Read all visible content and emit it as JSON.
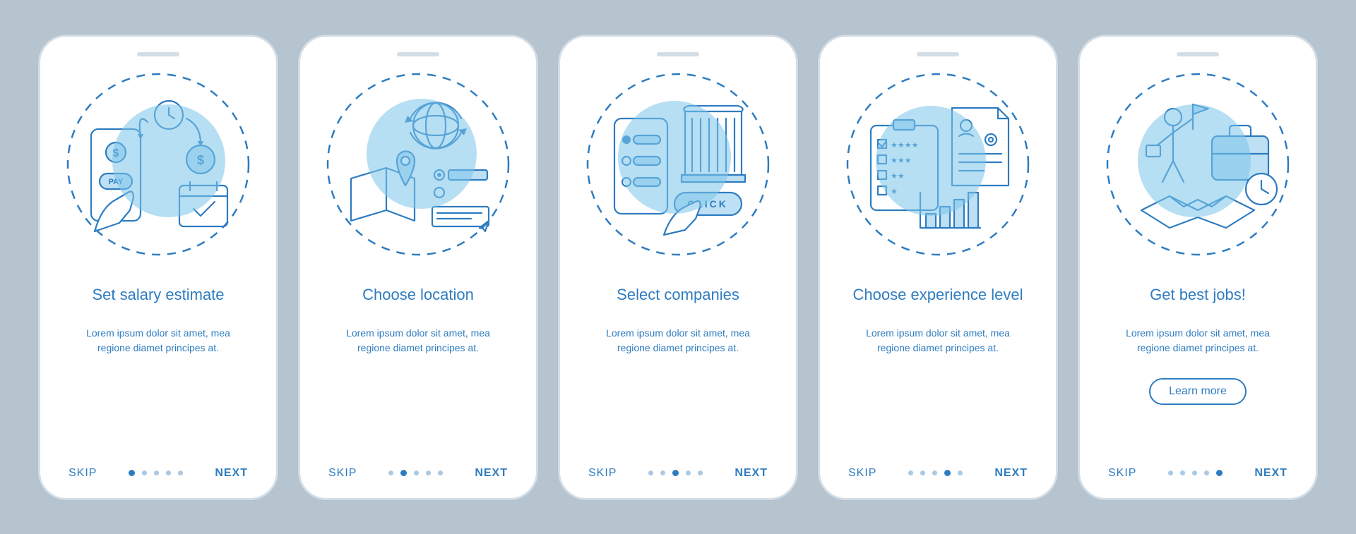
{
  "common": {
    "skip": "SKIP",
    "next": "NEXT",
    "learn_more": "Learn more",
    "lorem": "Lorem ipsum dolor sit amet, mea regione diamet principes at."
  },
  "screens": [
    {
      "title": "Set salary estimate",
      "active_dot": 0,
      "has_cta": false
    },
    {
      "title": "Choose location",
      "active_dot": 1,
      "has_cta": false
    },
    {
      "title": "Select companies",
      "active_dot": 2,
      "has_cta": false
    },
    {
      "title": "Choose experience level",
      "active_dot": 3,
      "has_cta": false
    },
    {
      "title": "Get best jobs!",
      "active_dot": 4,
      "has_cta": true
    }
  ],
  "dot_count": 5
}
